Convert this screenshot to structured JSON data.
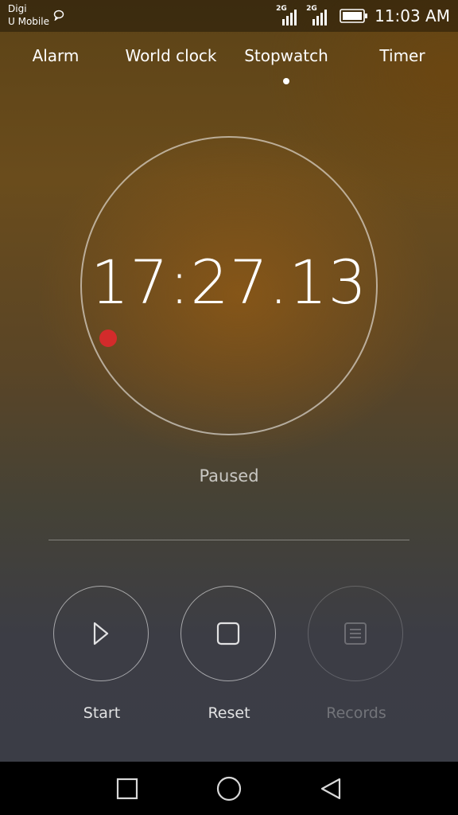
{
  "status_bar": {
    "carrier_1": "Digi",
    "carrier_2": "U Mobile",
    "signal_1_label": "2G",
    "signal_2_label": "2G",
    "time": "11:03 AM"
  },
  "tabs": [
    {
      "label": "Alarm"
    },
    {
      "label": "World clock"
    },
    {
      "label": "Stopwatch",
      "selected": true
    },
    {
      "label": "Timer"
    }
  ],
  "stopwatch": {
    "elapsed": "17:27.13",
    "state": "Paused"
  },
  "controls": {
    "start_label": "Start",
    "reset_label": "Reset",
    "records_label": "Records"
  },
  "colors": {
    "marker": "#d32b2b",
    "accent_text": "#ffffff"
  }
}
